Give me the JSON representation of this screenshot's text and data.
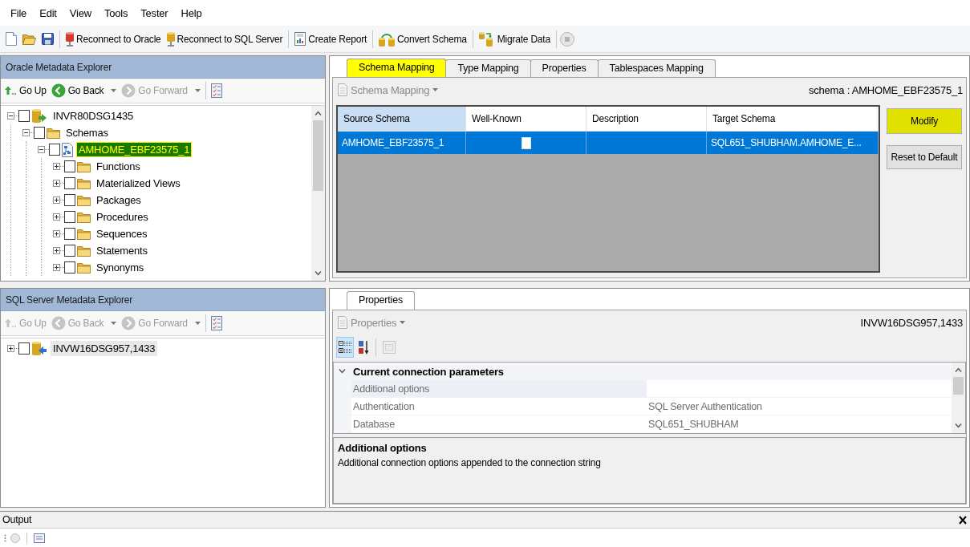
{
  "menu_bar": {
    "items": [
      {
        "label": "File"
      },
      {
        "label": "Edit"
      },
      {
        "label": "View"
      },
      {
        "label": "Tools"
      },
      {
        "label": "Tester"
      },
      {
        "label": "Help"
      }
    ]
  },
  "toolbar": {
    "buttons": [
      {
        "label": "Reconnect to Oracle"
      },
      {
        "label": "Reconnect to SQL Server"
      },
      {
        "label": "Create Report"
      },
      {
        "label": "Convert Schema"
      },
      {
        "label": "Migrate Data"
      }
    ],
    "stop_button": {
      "disabled": true
    }
  },
  "oracle_explorer": {
    "title": "Oracle Metadata Explorer",
    "nav": [
      {
        "label": "Go Up",
        "disabled": false,
        "has_menu": false
      },
      {
        "label": "Go Back",
        "disabled": false,
        "has_menu": true
      },
      {
        "label": "Go Forward",
        "disabled": true,
        "has_menu": true
      }
    ],
    "tree": {
      "focused": true,
      "nodes": [
        {
          "kind": "oracle_server",
          "label": "INVR80DSG1435",
          "expanded": true,
          "checked": false,
          "selected": false,
          "highlighted": false,
          "children": [
            {
              "kind": "folder",
              "label": "Schemas",
              "expanded": true,
              "checked": false,
              "selected": false,
              "highlighted": false,
              "children": [
                {
                  "kind": "schema",
                  "label": "AMHOME_EBF23575_1",
                  "expanded": true,
                  "checked": false,
                  "selected": true,
                  "highlighted": true,
                  "children": [
                    {
                      "kind": "folder",
                      "label": "Functions",
                      "expanded": false,
                      "checked": false,
                      "selected": false,
                      "highlighted": false
                    },
                    {
                      "kind": "folder",
                      "label": "Materialized Views",
                      "expanded": false,
                      "checked": false,
                      "selected": false,
                      "highlighted": false
                    },
                    {
                      "kind": "folder",
                      "label": "Packages",
                      "expanded": false,
                      "checked": false,
                      "selected": false,
                      "highlighted": false
                    },
                    {
                      "kind": "folder",
                      "label": "Procedures",
                      "expanded": false,
                      "checked": false,
                      "selected": false,
                      "highlighted": false
                    },
                    {
                      "kind": "folder",
                      "label": "Sequences",
                      "expanded": false,
                      "checked": false,
                      "selected": false,
                      "highlighted": false
                    },
                    {
                      "kind": "folder",
                      "label": "Statements",
                      "expanded": false,
                      "checked": false,
                      "selected": false,
                      "highlighted": false
                    },
                    {
                      "kind": "folder",
                      "label": "Synonyms",
                      "expanded": false,
                      "checked": false,
                      "selected": false,
                      "highlighted": false
                    }
                  ]
                }
              ]
            }
          ]
        }
      ]
    }
  },
  "schema_mapping_panel": {
    "tabs": [
      {
        "label": "Schema Mapping",
        "selected": true,
        "highlighted": true
      },
      {
        "label": "Type Mapping",
        "selected": false,
        "highlighted": false
      },
      {
        "label": "Properties",
        "selected": false,
        "highlighted": false
      },
      {
        "label": "Tablespaces Mapping",
        "selected": false,
        "highlighted": false
      }
    ],
    "toolbar": {
      "label": "Schema Mapping",
      "disabled": true
    },
    "context": "schema : AMHOME_EBF23575_1",
    "table": {
      "columns": [
        {
          "label": "Source Schema",
          "selected": true
        },
        {
          "label": "Well-Known",
          "selected": false
        },
        {
          "label": "Description",
          "selected": false
        },
        {
          "label": "Target Schema",
          "selected": false
        }
      ],
      "rows": [
        {
          "source_schema": "AMHOME_EBF23575_1",
          "well_known_checked": false,
          "target_schema": "SQL651_SHUBHAM.AMHOME_E...",
          "selected": true
        }
      ]
    },
    "buttons": [
      {
        "label": "Modify",
        "highlighted": true
      },
      {
        "label": "Reset to Default",
        "highlighted": false
      }
    ]
  },
  "sql_server_explorer": {
    "title": "SQL Server Metadata Explorer",
    "nav": [
      {
        "label": "Go Up",
        "disabled": true,
        "has_menu": false
      },
      {
        "label": "Go Back",
        "disabled": true,
        "has_menu": true
      },
      {
        "label": "Go Forward",
        "disabled": true,
        "has_menu": true
      }
    ],
    "tree": {
      "focused": false,
      "nodes": [
        {
          "kind": "sql_server",
          "label": "INVW16DSG957,1433",
          "expanded": false,
          "checked": false,
          "selected": true,
          "highlighted": false
        }
      ]
    }
  },
  "properties_panel": {
    "tabs": [
      {
        "label": "Properties",
        "selected": true,
        "highlighted": false
      }
    ],
    "toolbar": {
      "label": "Properties",
      "disabled": true
    },
    "context": "INVW16DSG957,1433",
    "view_buttons": [
      {
        "kind": "categorized",
        "selected": true,
        "disabled": false
      },
      {
        "kind": "alphabetical",
        "selected": false,
        "disabled": false
      },
      {
        "kind": "property_pages",
        "selected": false,
        "disabled": true
      }
    ],
    "grid": {
      "categories": [
        {
          "label": "Current connection parameters",
          "expanded": true,
          "rows": [
            {
              "name": "Additional options",
              "selected": true
            },
            {
              "name": "Authentication",
              "value": "SQL Server Authentication",
              "selected": false
            },
            {
              "name": "Database",
              "value": "SQL651_SHUBHAM",
              "selected": false
            }
          ]
        }
      ]
    },
    "description": {
      "title": "Additional options",
      "text": "Additional connection options appended to the connection string"
    }
  },
  "output": {
    "title": "Output"
  }
}
